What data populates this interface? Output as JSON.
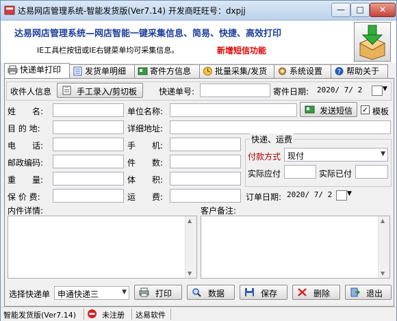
{
  "titlebar": {
    "title": "达易网店管理系统-智能发货版(Ver7.14) 开发商旺旺号：dxpjj",
    "min": "—",
    "max": "□",
    "close": "✕"
  },
  "banner": {
    "title": "达易网店管理系统—网店智能一键采集信息、简易、快捷、高效打印",
    "note": "IE工具栏按钮或IE右键菜单均可采集信息。",
    "new_feature": "新增短信功能"
  },
  "tabs": [
    {
      "label": "快递单打印",
      "icon": "printer-icon"
    },
    {
      "label": "发货单明细",
      "icon": "document-icon"
    },
    {
      "label": "寄件方信息",
      "icon": "card-icon"
    },
    {
      "label": "批量采集/发货",
      "icon": "clock-icon"
    },
    {
      "label": "系统设置",
      "icon": "gear-icon"
    },
    {
      "label": "帮助关于",
      "icon": "help-icon"
    }
  ],
  "form": {
    "receiver_info": "收件人信息",
    "manual_entry": "手工录入/剪切板",
    "waybill_no": "快递单号:",
    "ship_date_label": "寄件日期:",
    "ship_date": "2020/ 7/ 2",
    "name_label": "姓　　名:",
    "company_label": "单位名称:",
    "send_sms": "发送短信",
    "template": "模板",
    "template_checked": "✓",
    "destination_label": "目 的 地:",
    "address_label": "详细地址:",
    "phone_label": "电　　话:",
    "mobile_label": "手　　机:",
    "zip_label": "邮政编码:",
    "pieces_label": "件　　数:",
    "weight_label": "重　　量:",
    "volume_label": "体　　积:",
    "insurance_label": "保 价 费:",
    "freight_label": "运　　费:",
    "delivery_group": "快递、运费",
    "payment_label": "付款方式",
    "payment_value": "现付",
    "payable_label": "实际应付",
    "paid_label": "实际已付",
    "order_date_label": "订单日期:",
    "order_date": "2020/ 7/ 2",
    "contents_label": "内件详情:",
    "remarks_label": "客户备注:",
    "courier_label": "选择快递单",
    "courier_value": "申通快递三"
  },
  "buttons": {
    "print": "打印",
    "data": "数据",
    "save": "保存",
    "delete": "删除",
    "exit": "退出"
  },
  "status": {
    "version": "智能发货版(Ver7.14)",
    "unregistered": "未注册",
    "vendor": "达易软件"
  }
}
